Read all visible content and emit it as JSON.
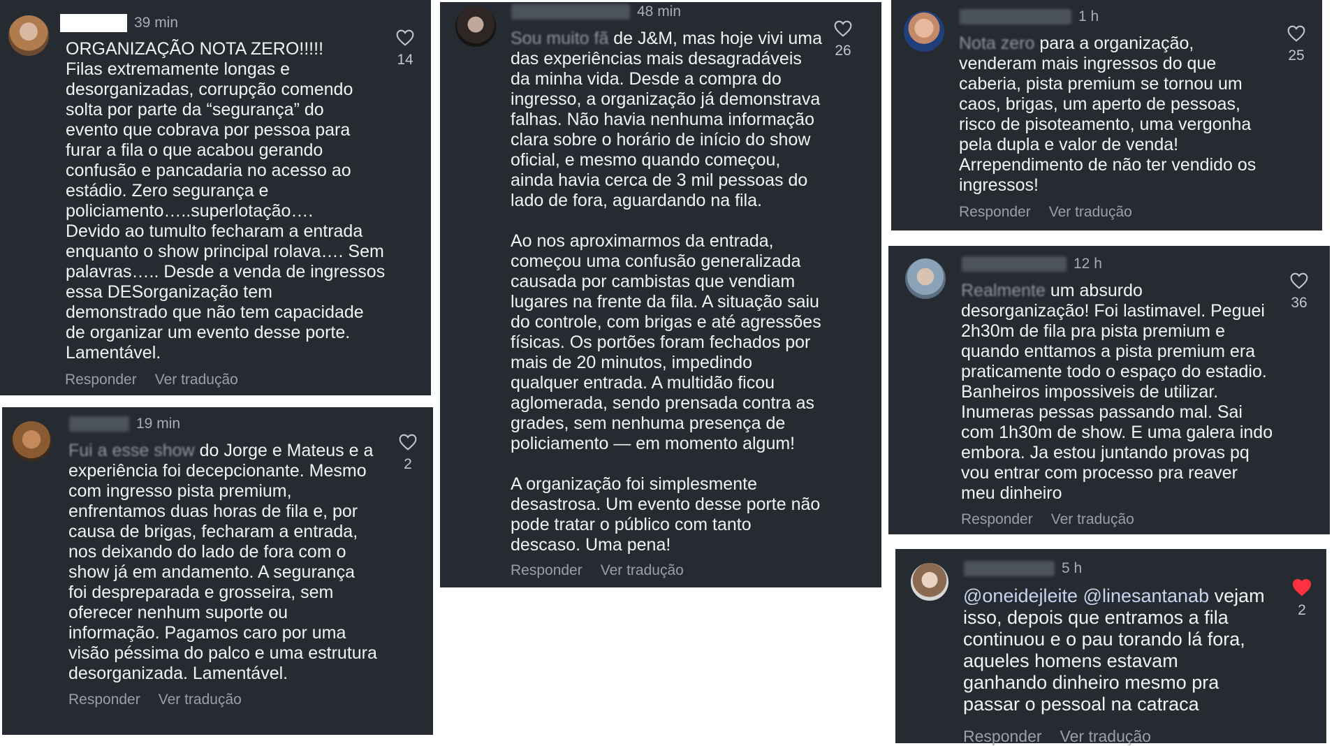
{
  "actions": {
    "reply": "Responder",
    "translate": "Ver tradução"
  },
  "comments": [
    {
      "time": "39 min",
      "text": "ORGANIZAÇÃO NOTA ZERO!!!!!\nFilas extremamente longas e\ndesorganizadas, corrupção comendo\nsolta por parte da “segurança” do\nevento que cobrava por pessoa para\nfurar a fila o que acabou gerando\nconfusão e pancadaria no acesso ao\nestádio. Zero segurança e\npoliciamento…..superlotação….\nDevido ao tumulto fecharam a entrada\nenquanto o show principal rolava…. Sem\npalavras….. Desde a venda de ingressos\nessa DESorganização tem\ndemonstrado que não tem capacidade\nde organizar um evento desse porte.\nLamentável.",
      "likes": "14"
    },
    {
      "time": "19 min",
      "text_start": "Fui a esse show",
      "text": " do Jorge e Mateus e a\nexperiência foi decepcionante. Mesmo\ncom ingresso pista premium,\nenfrentamos duas horas de fila e, por\ncausa de brigas, fecharam a entrada,\nnos deixando do lado de fora com o\nshow já em andamento. A segurança\nfoi despreparada e grosseira, sem\noferecer nenhum suporte ou\ninformação. Pagamos caro por uma\nvisão péssima do palco e uma estrutura\ndesorganizada. Lamentável.",
      "likes": "2"
    },
    {
      "time": "48 min",
      "text_start": "Sou muito fã",
      "text": " de J&M, mas hoje vivi uma\ndas experiências mais desagradáveis\nda minha vida. Desde a compra do\ningresso, a organização já demonstrava\nfalhas. Não havia nenhuma informação\nclara sobre o horário de início do show\noficial, e mesmo quando começou,\nainda havia cerca de 3 mil pessoas do\nlado de fora, aguardando na fila.\n\nAo nos aproximarmos da entrada,\ncomeçou uma confusão generalizada\ncausada por cambistas que vendiam\nlugares na frente da fila. A situação saiu\ndo controle, com brigas e até agressões\nfísicas. Os portões foram fechados por\nmais de 20 minutos, impedindo\nqualquer entrada. A multidão ficou\naglomerada, sendo prensada contra as\ngrades, sem nenhuma presença de\npoliciamento — em momento algum!\n\nA organização foi simplesmente\ndesastrosa. Um evento desse porte não\npode tratar o público com tanto\ndescaso. Uma pena!",
      "likes": "26"
    },
    {
      "time": "1 h",
      "text_start": "Nota zero",
      "text": " para a organização,\nvenderam mais ingressos do que\ncaberia, pista premium se tornou um\ncaos, brigas, um aperto de pessoas,\nrisco de pisoteamento, uma vergonha\npela dupla e valor de venda!\nArrependimento de não ter vendido os\ningressos!",
      "likes": "25"
    },
    {
      "time": "12 h",
      "text_start": "Realmente",
      "text": " um absurdo\ndesorganização! Foi lastimavel. Peguei\n2h30m de fila pra pista premium e\nquando enttamos a pista premium era\npraticamente todo o espaço do estadio.\nBanheiros impossiveis de utilizar.\nInumeras pessas passando mal. Sai\ncom 1h30m de show. E uma galera indo\nembora. Ja estou juntando provas pq\nvou entrar com processo pra reaver\nmeu dinheiro",
      "likes": "36"
    },
    {
      "time": "5 h",
      "mention1": "@oneidejleite",
      "mention2": "@linesantanab",
      "text": " vejam\nisso, depois que entramos a fila\ncontinuou e o pau torando lá fora,\naqueles homens estavam\nganhando dinheiro mesmo pra\npassar o pessoal na catraca",
      "likes": "2",
      "liked": true
    }
  ],
  "colors": {
    "card": "#262a31",
    "like_active": "#ff3040",
    "mention": "#c8d4ef"
  },
  "icons": {
    "like": "heart-icon",
    "avatar": "avatar"
  }
}
